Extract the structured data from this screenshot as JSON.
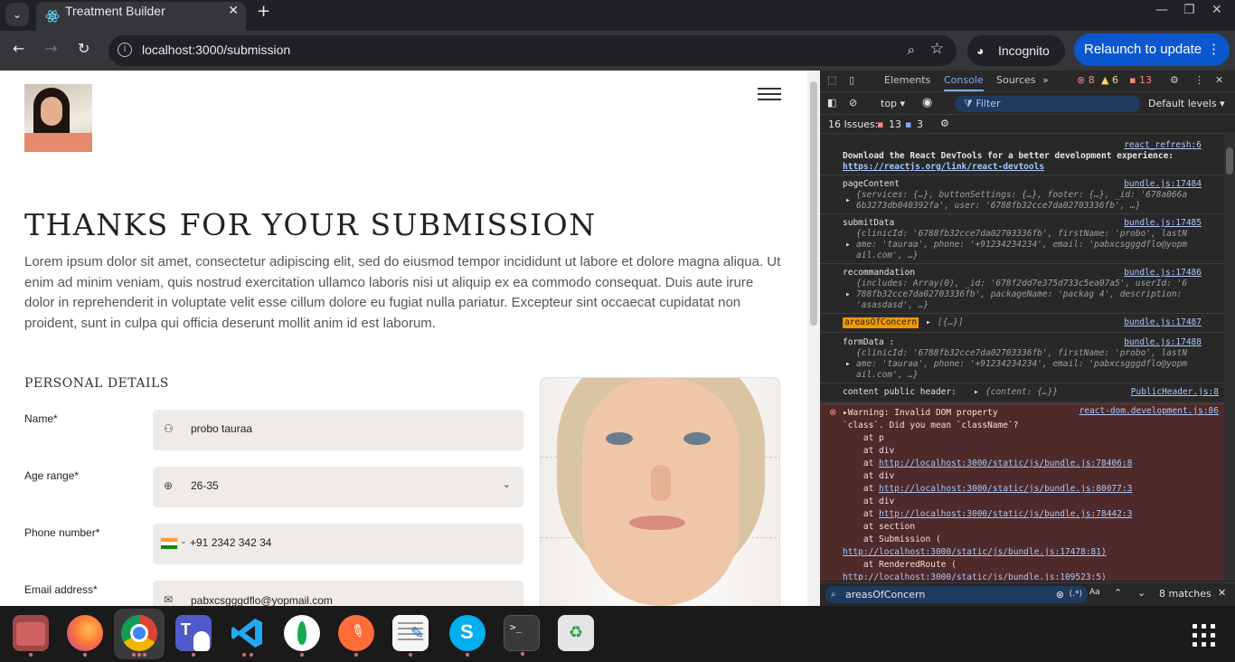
{
  "browser": {
    "tab_title": "Treatment Builder",
    "url": "localhost:3000/submission",
    "incognito_label": "Incognito",
    "relaunch_label": "Relaunch to update"
  },
  "page": {
    "heading": "THANKS FOR YOUR SUBMISSION",
    "paragraph": "Lorem ipsum dolor sit amet, consectetur adipiscing elit, sed do eiusmod tempor incididunt ut labore et dolore magna aliqua. Ut enim ad minim veniam, quis nostrud exercitation ullamco laboris nisi ut aliquip ex ea commodo consequat. Duis aute irure dolor in reprehenderit in voluptate velit esse cillum dolore eu fugiat nulla pariatur. Excepteur sint occaecat cupidatat non proident, sunt in culpa qui officia deserunt mollit anim id est laborum.",
    "section_title": "PERSONAL DETAILS",
    "fields": [
      {
        "label": "Name*",
        "value": "probo tauraa",
        "icon": "user-icon"
      },
      {
        "label": "Age range*",
        "value": "26-35",
        "icon": "target-icon"
      },
      {
        "label": "Phone number*",
        "value": "+91 2342 342 34",
        "icon": "india-flag-icon"
      },
      {
        "label": "Email address*",
        "value": "pabxcsgggdflo@yopmail.com",
        "icon": "mail-icon"
      }
    ]
  },
  "devtools": {
    "tabs": [
      "Elements",
      "Console",
      "Sources"
    ],
    "active_tab": "Console",
    "errors": "8",
    "warnings": "6",
    "messages": "13",
    "context": "top",
    "filter_placeholder": "Filter",
    "levels": "Default levels",
    "issues_label": "16 Issues:",
    "issues_errors": "13",
    "issues_info": "3",
    "logs": [
      {
        "source": "react_refresh:6",
        "line1": "Download the React DevTools for a better development experience:",
        "line2": "https://reactjs.org/link/react-devtools"
      },
      {
        "source": "bundle.js:17484",
        "label": "pageContent",
        "line1": "{services: {…}, buttonSettings: {…}, footer: {…}, _id: '678a066a",
        "line2": "6b3273db040392fa', user: '6788fb32cce7da02703336fb', …}"
      },
      {
        "source": "bundle.js:17485",
        "label": "submitData",
        "line1": "{clinicId: '6788fb32cce7da02703336fb', firstName: 'probo', lastN",
        "line2": "ame: 'tauraa', phone: '+91234234234', email: 'pabxcsgggdflo@yopm",
        "line3": "ail.com', …}"
      },
      {
        "source": "bundle.js:17486",
        "label": "recommandation",
        "line1": "{includes: Array(0), _id: '678f2dd7e375d733c5ea07a5', userId: '6",
        "line2": "788fb32cce7da02703336fb', packageName: 'packag 4', description:",
        "line3": "'asasdasd', …}"
      },
      {
        "source": "bundle.js:17487",
        "label": "areasOfConcern",
        "value": "[{…}]"
      },
      {
        "source": "bundle.js:17488",
        "label": "formData :",
        "line1": "{clinicId: '6788fb32cce7da02703336fb', firstName: 'probo', lastN",
        "line2": "ame: 'tauraa', phone: '+91234234234', email: 'pabxcsgggdflo@yopm",
        "line3": "ail.com', …}"
      },
      {
        "source": "PublicHeader.js:8",
        "label": "content public header:",
        "value": "{content: {…}}"
      }
    ],
    "warning": {
      "source": "react-dom.development.js:86",
      "lines": [
        "Warning: Invalid DOM property",
        "`class`. Did you mean `className`?",
        "    at p",
        "    at div",
        "    at ",
        "    at div",
        "    at ",
        "    at div",
        "    at ",
        "    at section",
        "    at Submission (",
        "",
        "    at RenderedRoute (",
        ""
      ],
      "links": [
        "http://localhost:3000/static/js/bundle.js:78406:8",
        "http://localhost:3000/static/js/bundle.js:80077:3",
        "http://localhost:3000/static/js/bundle.js:78442:3",
        "http://localhost:3000/static/js/bundle.js:17478:81)",
        "http://localhost:3000/static/js/bundle.js:109523:5)"
      ]
    },
    "search_query": "areasOfConcern",
    "search_matches": "8 matches"
  },
  "colors": {
    "accent": "#0b57d0",
    "page_bg": "#ffffff",
    "devtools_bg": "#282828",
    "field_bg": "#efebe8"
  }
}
